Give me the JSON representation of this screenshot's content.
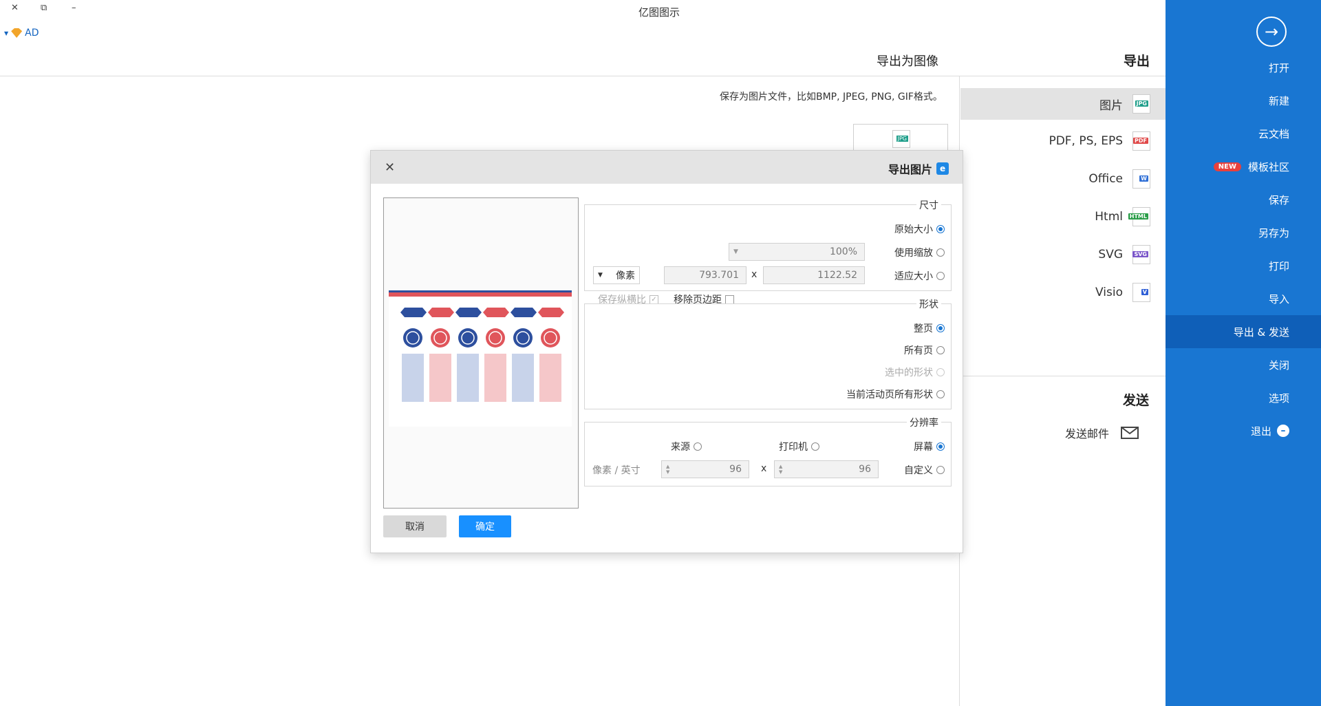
{
  "window": {
    "title": "亿图图示",
    "user": "AD",
    "btn_close": "✕",
    "btn_restore": "⧉",
    "btn_min": "–"
  },
  "nav": {
    "back_icon": "→",
    "items": [
      {
        "label": "打开"
      },
      {
        "label": "新建"
      },
      {
        "label": "云文档"
      },
      {
        "label": "模板社区",
        "badge": "NEW"
      },
      {
        "label": "保存"
      },
      {
        "label": "另存为"
      },
      {
        "label": "打印"
      },
      {
        "label": "导入"
      },
      {
        "label": "导出 & 发送"
      },
      {
        "label": "关闭"
      },
      {
        "label": "选项"
      },
      {
        "label": "退出"
      }
    ]
  },
  "export": {
    "section_title": "导出",
    "formats": [
      {
        "label": "图片",
        "icon": "JPG",
        "color": "#1e9e8a"
      },
      {
        "label": "PDF, PS, EPS",
        "icon": "PDF",
        "color": "#e04848"
      },
      {
        "label": "Office",
        "icon": "W",
        "color": "#2f6fd6"
      },
      {
        "label": "Html",
        "icon": "HTML",
        "color": "#2a9d48"
      },
      {
        "label": "SVG",
        "icon": "SVG",
        "color": "#7a55c9"
      },
      {
        "label": "Visio",
        "icon": "V",
        "color": "#2f5fd6"
      }
    ],
    "send_title": "发送",
    "send_email": "发送邮件"
  },
  "detail": {
    "heading": "导出为图像",
    "desc": "保存为图片文件，比如BMP, JPEG, PNG, GIF格式。",
    "thumb_icon": "JPG"
  },
  "dialog": {
    "title": "导出图片",
    "size_group": "尺寸",
    "opt_original": "原始大小",
    "opt_zoom": "使用缩放",
    "zoom_value": "100%",
    "opt_fit": "适应大小",
    "width": "1122.52",
    "height": "793.701",
    "x_label": "x",
    "unit": "像素",
    "remove_margin": "移除页边距",
    "keep_ratio": "保存纵横比",
    "shape_group": "形状",
    "opt_whole_page": "整页",
    "opt_all_pages": "所有页",
    "opt_selected": "选中的形状",
    "opt_current_page_shapes": "当前活动页所有形状",
    "res_group": "分辨率",
    "opt_screen": "屏幕",
    "opt_printer": "打印机",
    "opt_source": "来源",
    "opt_custom": "自定义",
    "res_x": "96",
    "res_y": "96",
    "res_unit": "像素 / 英寸",
    "ok": "确定",
    "cancel": "取消"
  }
}
